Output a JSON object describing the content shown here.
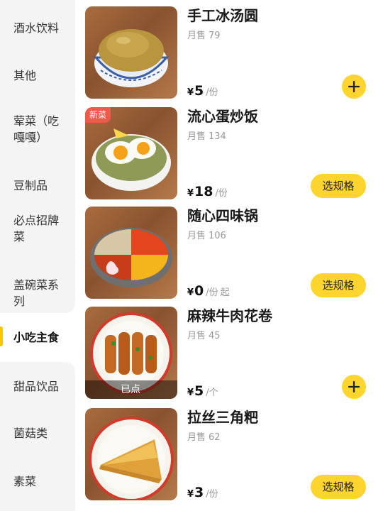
{
  "sidebar": {
    "items": [
      {
        "label": "酒水饮料"
      },
      {
        "label": "其他"
      },
      {
        "label": "荤菜（吃嘎嘎）"
      },
      {
        "label": "豆制品"
      },
      {
        "label": "必点招牌菜"
      },
      {
        "label": "盖碗菜系列"
      },
      {
        "label": "小吃主食",
        "active": true
      },
      {
        "label": "甜品饮品"
      },
      {
        "label": "菌菇类"
      },
      {
        "label": "素菜"
      }
    ]
  },
  "products": [
    {
      "name": "手工冰汤圆",
      "sold_label": "月售",
      "sold_count": "79",
      "currency": "¥",
      "price": "5",
      "unit": "/份",
      "suffix": "",
      "action": "add",
      "badge": "",
      "tag": ""
    },
    {
      "name": "流心蛋炒饭",
      "sold_label": "月售",
      "sold_count": "134",
      "currency": "¥",
      "price": "18",
      "unit": "/份",
      "suffix": "",
      "action": "spec",
      "action_label": "选规格",
      "badge": "新菜",
      "tag": ""
    },
    {
      "name": "随心四味锅",
      "sold_label": "月售",
      "sold_count": "106",
      "currency": "¥",
      "price": "0",
      "unit": "/份",
      "suffix": "起",
      "action": "spec",
      "action_label": "选规格",
      "badge": "",
      "tag": ""
    },
    {
      "name": "麻辣牛肉花卷",
      "sold_label": "月售",
      "sold_count": "45",
      "currency": "¥",
      "price": "5",
      "unit": "/个",
      "suffix": "",
      "action": "add",
      "badge": "",
      "tag": "已点"
    },
    {
      "name": "拉丝三角粑",
      "sold_label": "月售",
      "sold_count": "62",
      "currency": "¥",
      "price": "3",
      "unit": "/份",
      "suffix": "",
      "action": "spec",
      "action_label": "选规格",
      "badge": "",
      "tag": ""
    }
  ],
  "colors": {
    "accent": "#fed42f",
    "new_badge": "#f05a4a",
    "active_bar": "#f7c600"
  },
  "icons": {
    "add": "plus-icon"
  }
}
